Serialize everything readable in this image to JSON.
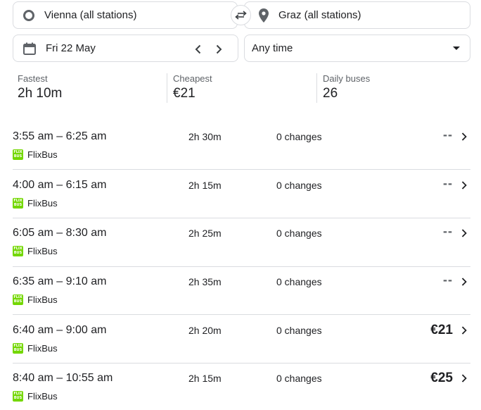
{
  "search": {
    "origin": "Vienna (all stations)",
    "destination": "Graz (all stations)",
    "date": "Fri 22 May",
    "time": "Any time"
  },
  "stats": {
    "fastest_label": "Fastest",
    "fastest_value": "2h 10m",
    "cheapest_label": "Cheapest",
    "cheapest_value": "€21",
    "daily_label": "Daily buses",
    "daily_value": "26"
  },
  "operator_logo_text": "FLIX BUS",
  "colors": {
    "flixbus_green": "#73d700",
    "border": "#dadce0",
    "muted": "#5f6368"
  },
  "results": [
    {
      "times": "3:55 am – 6:25 am",
      "duration": "2h 30m",
      "changes": "0 changes",
      "price": "--",
      "operator": "FlixBus"
    },
    {
      "times": "4:00 am – 6:15 am",
      "duration": "2h 15m",
      "changes": "0 changes",
      "price": "--",
      "operator": "FlixBus"
    },
    {
      "times": "6:05 am – 8:30 am",
      "duration": "2h 25m",
      "changes": "0 changes",
      "price": "--",
      "operator": "FlixBus"
    },
    {
      "times": "6:35 am – 9:10 am",
      "duration": "2h 35m",
      "changes": "0 changes",
      "price": "--",
      "operator": "FlixBus"
    },
    {
      "times": "6:40 am – 9:00 am",
      "duration": "2h 20m",
      "changes": "0 changes",
      "price": "€21",
      "operator": "FlixBus"
    },
    {
      "times": "8:40 am – 10:55 am",
      "duration": "2h 15m",
      "changes": "0 changes",
      "price": "€25",
      "operator": "FlixBus"
    }
  ]
}
